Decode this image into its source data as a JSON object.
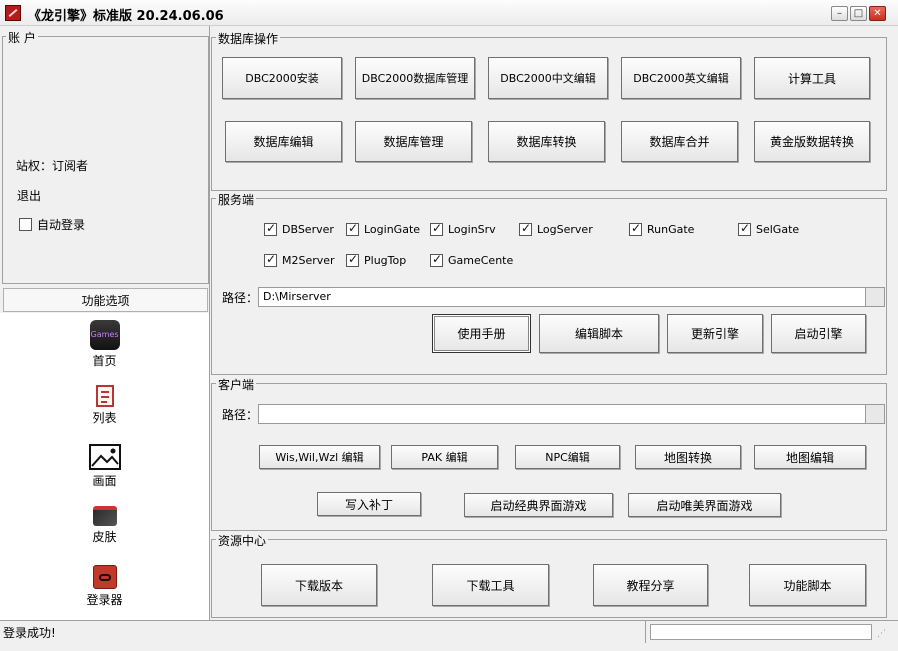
{
  "window": {
    "title": "《龙引擎》标准版 20.24.06.06",
    "minimize": "–",
    "maximize": "□",
    "close": "✕"
  },
  "account": {
    "legend": "账 户",
    "permission": "站权：订阅者",
    "logout": "退出",
    "autologin": "自动登录",
    "autologin_checked": false
  },
  "sidebar": {
    "header": "功能选项",
    "items": [
      {
        "label": "首页",
        "icon": "games-icon"
      },
      {
        "label": "列表",
        "icon": "list-icon"
      },
      {
        "label": "画面",
        "icon": "picture-icon"
      },
      {
        "label": "皮肤",
        "icon": "skin-icon"
      },
      {
        "label": "登录器",
        "icon": "launcher-icon"
      }
    ],
    "games_icon_text": "Games"
  },
  "db": {
    "legend": "数据库操作",
    "row1": [
      "DBC2000安装",
      "DBC2000数据库管理",
      "DBC2000中文编辑",
      "DBC2000英文编辑",
      "计算工具"
    ],
    "row2": [
      "数据库编辑",
      "数据库管理",
      "数据库转换",
      "数据库合并",
      "黄金版数据转换"
    ]
  },
  "server": {
    "legend": "服务端",
    "checks": [
      {
        "label": "DBServer",
        "checked": true
      },
      {
        "label": "LoginGate",
        "checked": true
      },
      {
        "label": "LoginSrv",
        "checked": true
      },
      {
        "label": "LogServer",
        "checked": true
      },
      {
        "label": "RunGate",
        "checked": true
      },
      {
        "label": "SelGate",
        "checked": true
      },
      {
        "label": "M2Server",
        "checked": true
      },
      {
        "label": "PlugTop",
        "checked": true
      },
      {
        "label": "GameCente",
        "checked": true
      }
    ],
    "path_label": "路径：",
    "path_value": "D:\\Mirserver",
    "buttons": [
      "使用手册",
      "编辑脚本",
      "更新引擎",
      "启动引擎"
    ]
  },
  "client": {
    "legend": "客户端",
    "path_label": "路径：",
    "path_value": "",
    "row1": [
      "Wis,Wil,Wzl 编辑",
      "PAK 编辑",
      "NPC编辑",
      "地图转换",
      "地图编辑"
    ],
    "row2": [
      "写入补丁",
      "启动经典界面游戏",
      "启动唯美界面游戏"
    ]
  },
  "resources": {
    "legend": "资源中心",
    "buttons": [
      "下载版本",
      "下载工具",
      "教程分享",
      "功能脚本"
    ]
  },
  "status": {
    "message": "登录成功!",
    "right_field": ""
  }
}
